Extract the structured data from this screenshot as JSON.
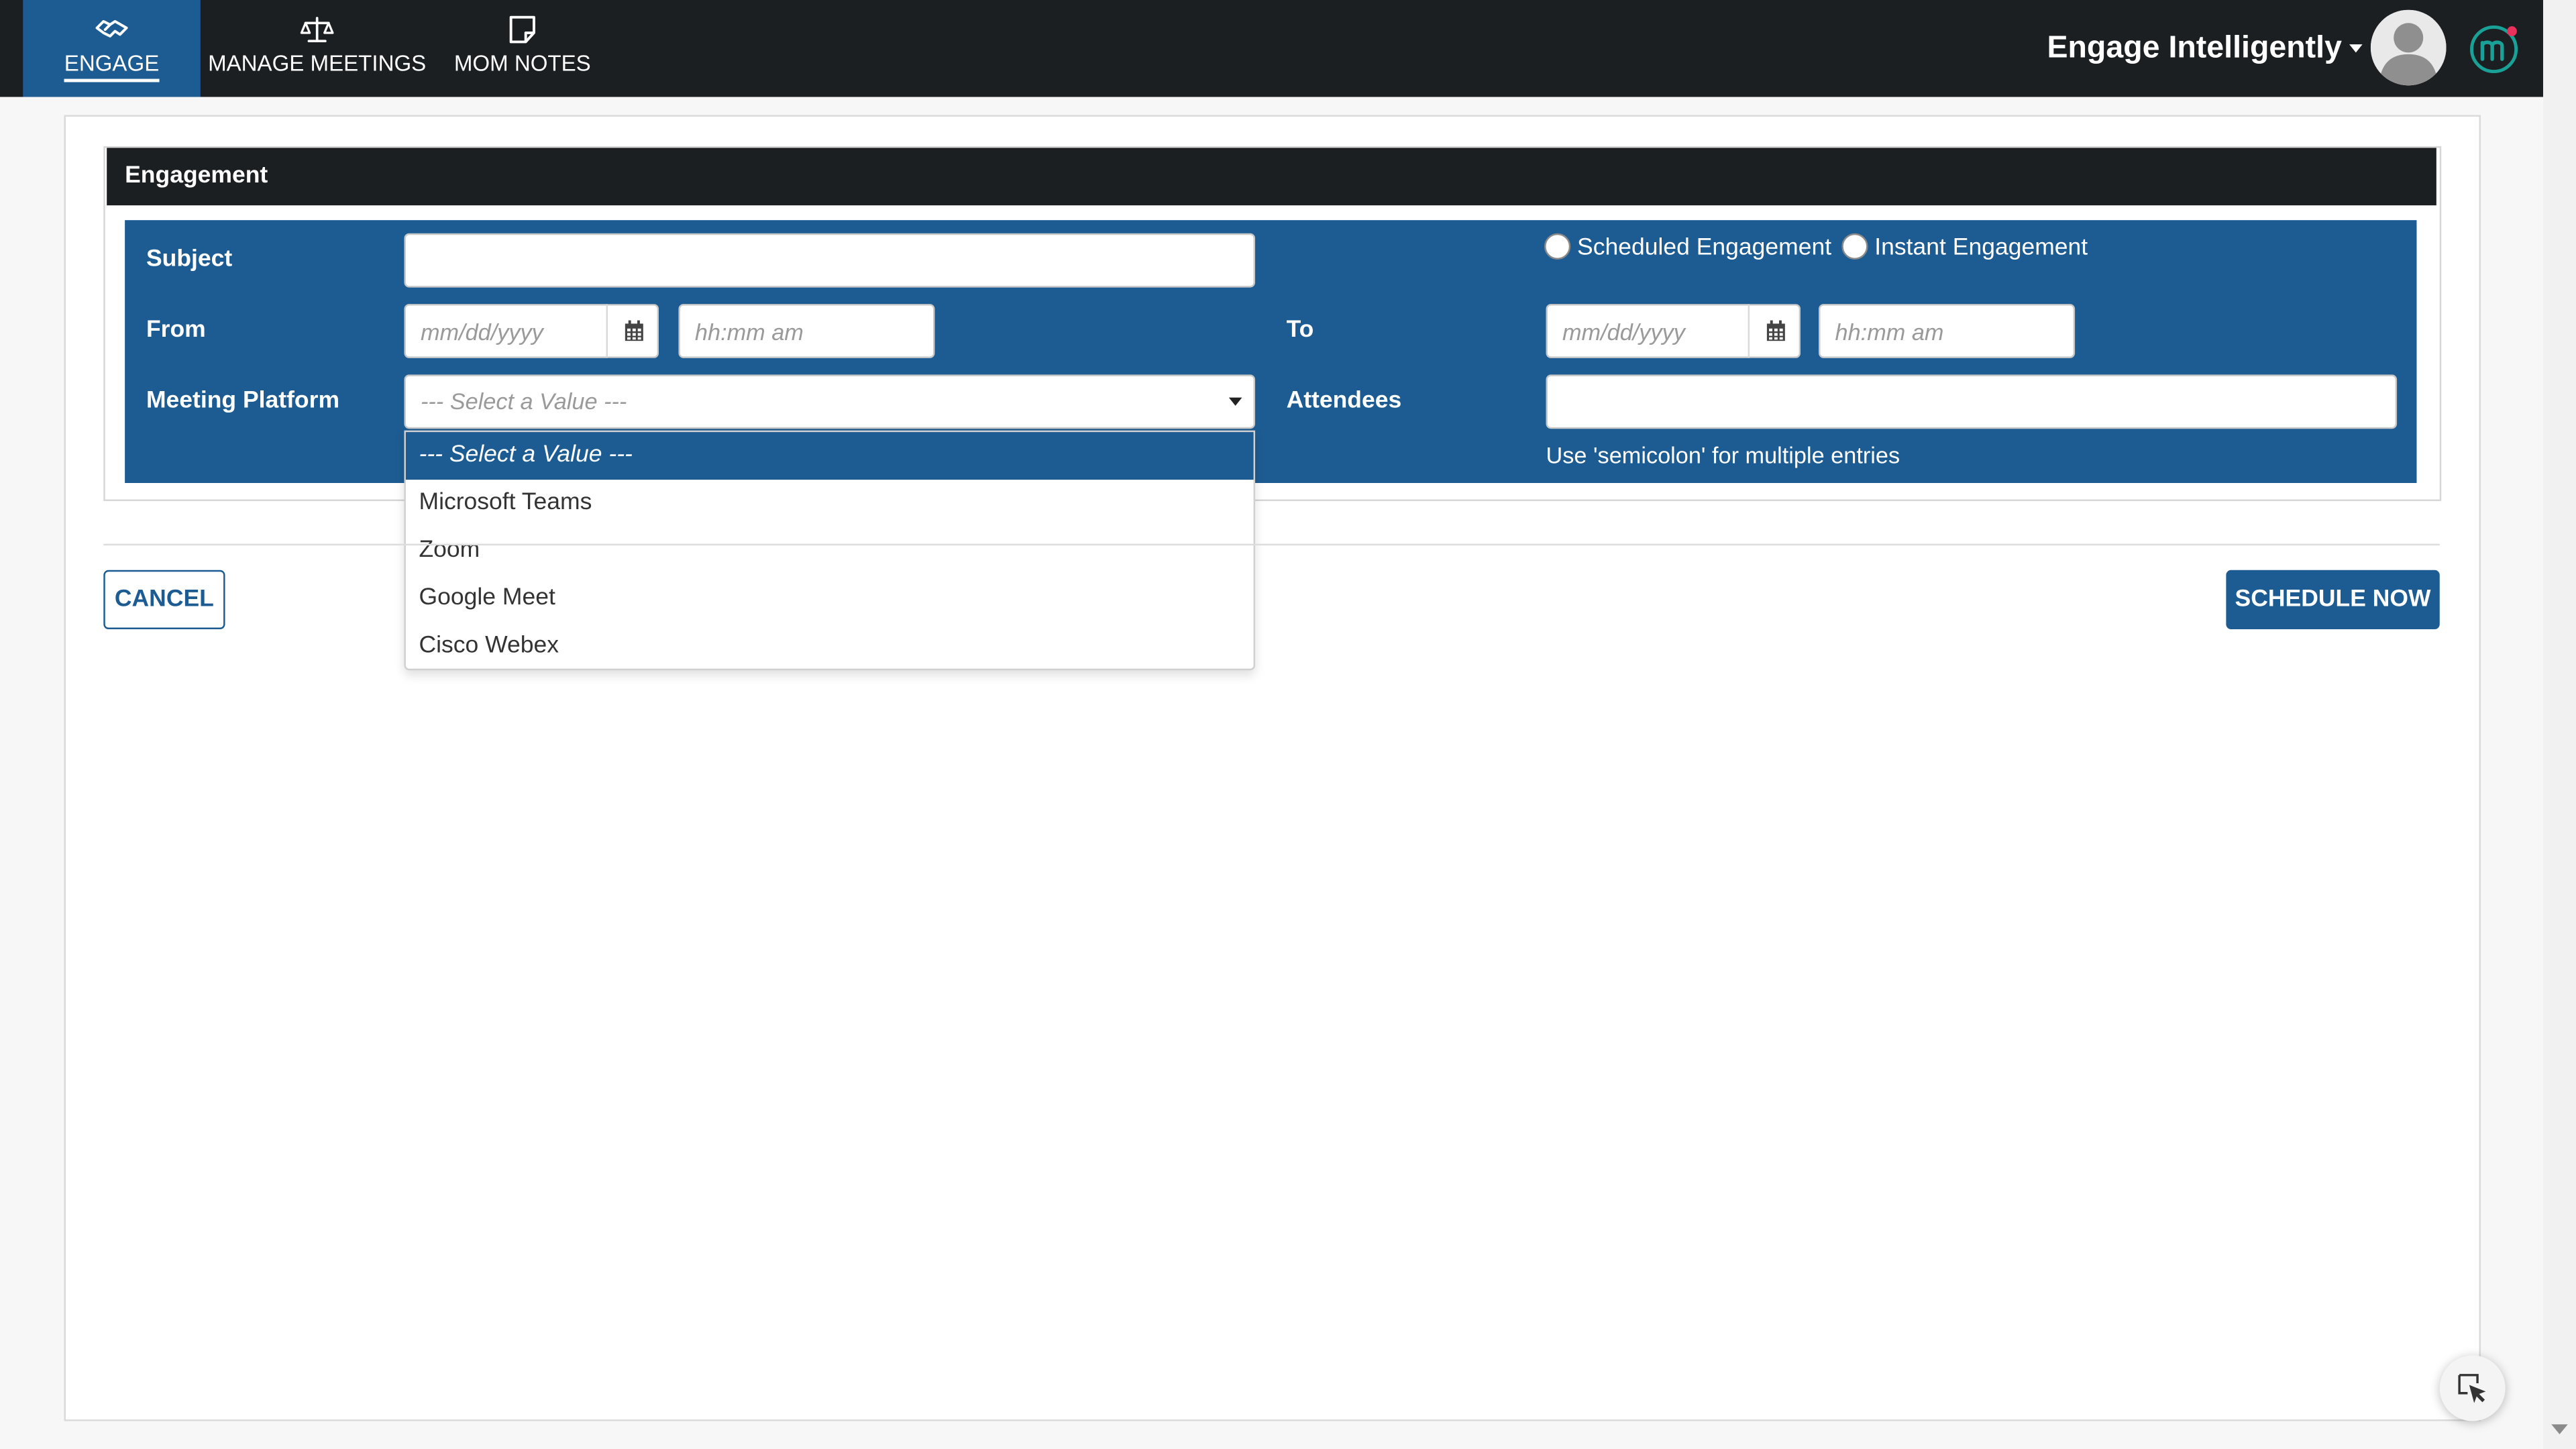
{
  "app": {
    "brand_name": "Engage Intelligently",
    "colors": {
      "topbar": "#1c1f22",
      "accent": "#1d5c92",
      "logo_ring": "#1aa197",
      "logo_dot": "#e8315b"
    }
  },
  "nav": {
    "items": [
      {
        "label": "ENGAGE",
        "icon": "handshake-icon",
        "active": true
      },
      {
        "label": "MANAGE MEETINGS",
        "icon": "scale-icon",
        "active": false
      },
      {
        "label": "MOM NOTES",
        "icon": "note-icon",
        "active": false
      }
    ]
  },
  "header": {
    "avatar_icon": "user-avatar-icon",
    "logo_icon": "app-logo-icon",
    "dropdown_icon": "caret-down-icon"
  },
  "section": {
    "title": "Engagement"
  },
  "form": {
    "subject": {
      "label": "Subject",
      "value": "",
      "placeholder": ""
    },
    "engagement_type": {
      "options": [
        {
          "label": "Scheduled Engagement",
          "selected": false
        },
        {
          "label": "Instant Engagement",
          "selected": false
        }
      ]
    },
    "from": {
      "label": "From",
      "date_placeholder": "mm/dd/yyyy",
      "time_placeholder": "hh:mm am",
      "calendar_icon": "calendar-icon"
    },
    "to": {
      "label": "To",
      "date_placeholder": "mm/dd/yyyy",
      "time_placeholder": "hh:mm am",
      "calendar_icon": "calendar-icon"
    },
    "meeting_platform": {
      "label": "Meeting Platform",
      "selected": "--- Select a Value ---",
      "options": [
        "--- Select a Value ---",
        "Microsoft Teams",
        "Zoom",
        "Google Meet",
        "Cisco Webex"
      ],
      "highlighted_index": 0
    },
    "attendees": {
      "label": "Attendees",
      "value": "",
      "helper": "Use 'semicolon' for multiple entries"
    }
  },
  "actions": {
    "cancel_label": "CANCEL",
    "schedule_label": "SCHEDULE NOW"
  },
  "floating": {
    "icon": "cursor-select-icon"
  }
}
